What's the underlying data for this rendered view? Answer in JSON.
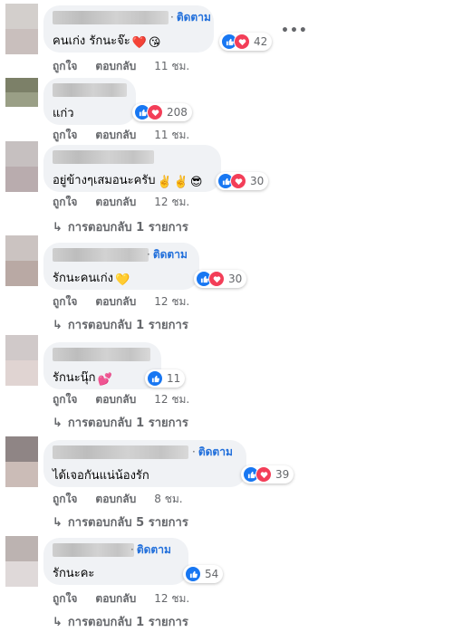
{
  "follow_label": "ติดตาม",
  "like_label": "ถูกใจ",
  "reply_label": "ตอบกลับ",
  "more_label": "•••",
  "comments": [
    {
      "text": "คนเก่ง รักนะจ๊ะ",
      "emojis": [
        "❤️",
        "😘"
      ],
      "reaction_count": "42",
      "time": "11 ชม.",
      "replies": ""
    },
    {
      "text": "แก่ว",
      "emojis": [],
      "reaction_count": "208",
      "time": "11 ชม.",
      "replies": ""
    },
    {
      "text": "อยู่ข้างๆเสมอนะครับ",
      "emojis": [
        "✌️",
        "✌️",
        "😎"
      ],
      "reaction_count": "30",
      "time": "12 ชม.",
      "replies": "การตอบกลับ 1 รายการ"
    },
    {
      "text": "รักนะคนเก่ง",
      "emojis": [
        "💛"
      ],
      "reaction_count": "30",
      "time": "12 ชม.",
      "replies": "การตอบกลับ 1 รายการ"
    },
    {
      "text": "รักนะนุ๊ก",
      "emojis": [
        "💕"
      ],
      "reaction_count": "11",
      "time": "12 ชม.",
      "replies": "การตอบกลับ 1 รายการ"
    },
    {
      "text": "ได้เจอกันแน่น้องรัก",
      "emojis": [],
      "reaction_count": "39",
      "time": "8 ชม.",
      "replies": "การตอบกลับ 5 รายการ"
    },
    {
      "text": "รักนะคะ",
      "emojis": [],
      "reaction_count": "54",
      "time": "12 ชม.",
      "replies": "การตอบกลับ 1 รายการ"
    }
  ],
  "colors": {
    "link_blue": "#216fdb",
    "like_blue": "#1877f2",
    "love_red": "#f33e58",
    "bubble_bg": "#f0f2f5",
    "meta_gray": "#65676b"
  }
}
